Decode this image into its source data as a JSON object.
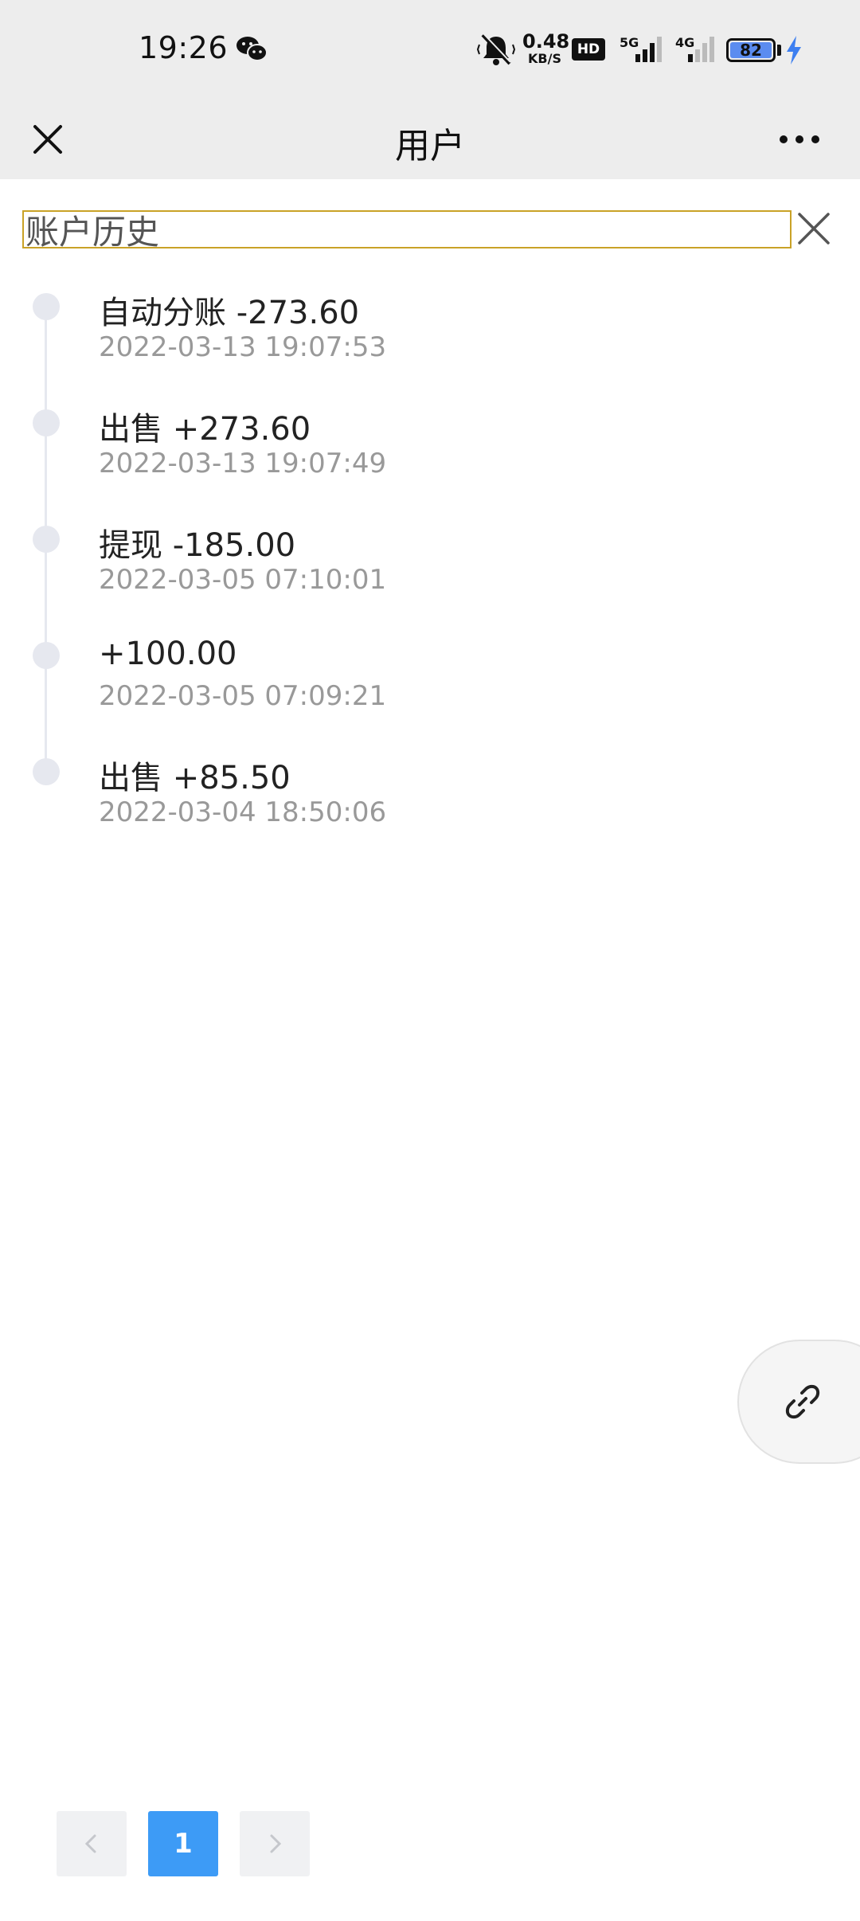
{
  "status_bar": {
    "time": "19:26",
    "net_speed_value": "0.48",
    "net_speed_unit": "KB/S",
    "hd_label": "HD",
    "network_5g": "5G",
    "network_4g": "4G",
    "battery_level": "82",
    "icons": [
      "wechat-icon",
      "mute-icon",
      "signal-icon",
      "battery-icon",
      "charging-icon"
    ]
  },
  "nav": {
    "title": "用户",
    "icons": [
      "close-icon",
      "more-icon"
    ]
  },
  "history_input": {
    "value": "账户历史"
  },
  "timeline": {
    "items": [
      {
        "title": "自动分账 -273.60",
        "time": "2022-03-13 19:07:53"
      },
      {
        "title": "出售 +273.60",
        "time": "2022-03-13 19:07:49"
      },
      {
        "title": "提现 -185.00",
        "time": "2022-03-05 07:10:01"
      },
      {
        "title": "+100.00",
        "time": "2022-03-05 07:09:21"
      },
      {
        "title": "出售 +85.50",
        "time": "2022-03-04 18:50:06"
      }
    ]
  },
  "pagination": {
    "current_page": "1"
  },
  "colors": {
    "accent": "#3d9bf6",
    "input_border": "#c9a227",
    "timeline_dot": "#e6e8ef",
    "battery": "#5b8cf0"
  }
}
